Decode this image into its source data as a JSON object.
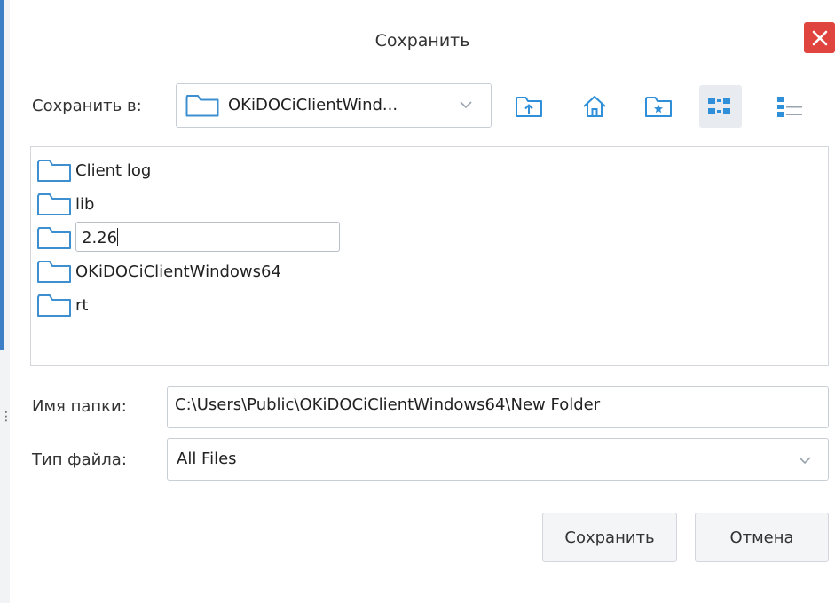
{
  "dialog": {
    "title": "Сохранить"
  },
  "save_in": {
    "label": "Сохранить в:",
    "value": "OKiDOCiClientWind..."
  },
  "toolbar": [
    "up-folder-icon",
    "home-icon",
    "new-folder-icon",
    "list-view-icon",
    "details-view-icon"
  ],
  "files": [
    {
      "name": "Client log",
      "icon": "folder-icon"
    },
    {
      "name": "lib",
      "icon": "folder-icon"
    },
    {
      "name": "2.26",
      "icon": "folder-icon",
      "editing": true
    },
    {
      "name": "OKiDOCiClientWindows64",
      "icon": "folder-icon"
    },
    {
      "name": "rt",
      "icon": "folder-icon"
    }
  ],
  "folder_name": {
    "label": "Имя папки:",
    "value": "C:\\Users\\Public\\OKiDOCiClientWindows64\\New Folder"
  },
  "file_type": {
    "label": "Тип файла:",
    "value": "All Files"
  },
  "buttons": {
    "save": "Сохранить",
    "cancel": "Отмена"
  },
  "colors": {
    "accent": "#3d7fc7",
    "close": "#e0443e",
    "folder": "#3d8fd0"
  }
}
